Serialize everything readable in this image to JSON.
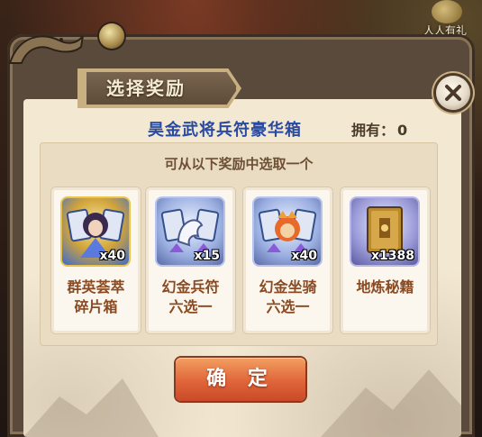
{
  "hud": {
    "badge_text": "人人有礼"
  },
  "dialog": {
    "title": "选择奖励",
    "package_name": "昊金武将兵符豪华箱",
    "owned_label": "拥有：",
    "owned_value": "0",
    "instruction": "可从以下奖励中选取一个",
    "confirm_label": "确 定"
  },
  "rewards": [
    {
      "name_line1": "群英荟萃",
      "name_line2": "碎片箱",
      "qty": "x40",
      "icon": "hero-fragment-box-icon"
    },
    {
      "name_line1": "幻金兵符",
      "name_line2": "六选一",
      "qty": "x15",
      "icon": "dragon-token-choice-icon"
    },
    {
      "name_line1": "幻金坐骑",
      "name_line2": "六选一",
      "qty": "x40",
      "icon": "mount-choice-icon"
    },
    {
      "name_line1": "地炼秘籍",
      "name_line2": "",
      "qty": "x1388",
      "icon": "secret-book-icon"
    }
  ],
  "colors": {
    "title_blue": "#2a4aa0",
    "reward_text": "#8a4a22",
    "confirm_orange": "#e0653a"
  }
}
